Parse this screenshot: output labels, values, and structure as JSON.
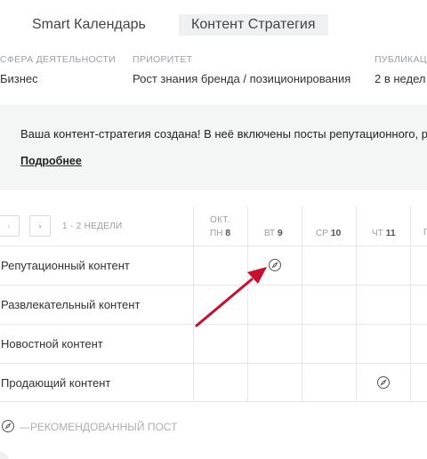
{
  "tabs": [
    {
      "label": "Smart Календарь"
    },
    {
      "label": "Контент Стратегия"
    }
  ],
  "meta": {
    "sphere": {
      "label": "СФЕРА ДЕЯТЕЛЬНОСТИ",
      "value": "Бизнес"
    },
    "priority": {
      "label": "ПРИОРИТЕТ",
      "value": "Рост знания бренда / позиционирования"
    },
    "publications": {
      "label": "ПУБЛИКАЦ",
      "value": "2 в недел"
    }
  },
  "notice": {
    "text": "Ваша контент-стратегия создана!   В неё включены посты репутационного, р",
    "link": "Подробнее"
  },
  "calendar": {
    "nav_prev": "‹",
    "nav_next": "›",
    "weeks_label": "1 - 2 НЕДЕЛИ",
    "month": "ОКТ.",
    "days": [
      {
        "weekday": "ПН",
        "date": "8"
      },
      {
        "weekday": "ВТ",
        "date": "9"
      },
      {
        "weekday": "СР",
        "date": "10"
      },
      {
        "weekday": "ЧТ",
        "date": "11"
      },
      {
        "weekday": "П",
        "date": ""
      }
    ],
    "rows": [
      {
        "label": "Репутационный контент"
      },
      {
        "label": "Развлекательный контент"
      },
      {
        "label": "Новостной контент"
      },
      {
        "label": "Продающий контент"
      }
    ]
  },
  "legend": {
    "text": "—РЕКОМЕНДОВАННЫЙ ПОСТ",
    "icon": "compass-icon"
  },
  "colors": {
    "arrow": "#c8102e",
    "notice_bg": "#f4f6f6",
    "tab_active_bg": "#eef0f2"
  }
}
